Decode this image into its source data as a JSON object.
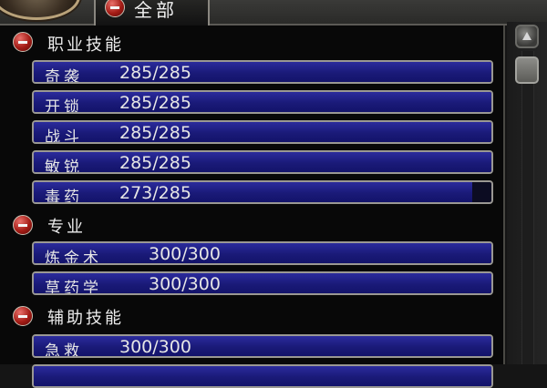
{
  "tab": {
    "label": "全部"
  },
  "categories": [
    {
      "label": "职业技能",
      "skills": [
        {
          "name": "奇袭",
          "value": "285/285",
          "progress": 1.0
        },
        {
          "name": "开锁",
          "value": "285/285",
          "progress": 1.0
        },
        {
          "name": "战斗",
          "value": "285/285",
          "progress": 1.0
        },
        {
          "name": "敏锐",
          "value": "285/285",
          "progress": 1.0
        },
        {
          "name": "毒药",
          "value": "273/285",
          "progress": 0.958
        }
      ]
    },
    {
      "label": "专业",
      "skills": [
        {
          "name": "炼金术",
          "value": "300/300",
          "progress": 1.0
        },
        {
          "name": "草药学",
          "value": "300/300",
          "progress": 1.0
        }
      ]
    },
    {
      "label": "辅助技能",
      "skills": [
        {
          "name": "急救",
          "value": "300/300",
          "progress": 1.0
        }
      ]
    }
  ],
  "colors": {
    "bar_fill": "#1a1a78",
    "bar_border": "#9a9893",
    "toggle_red": "#a41c16",
    "text": "#e6e6e6"
  },
  "icons": {
    "toggle": "minus-icon",
    "scroll_up": "arrow-up-icon"
  }
}
